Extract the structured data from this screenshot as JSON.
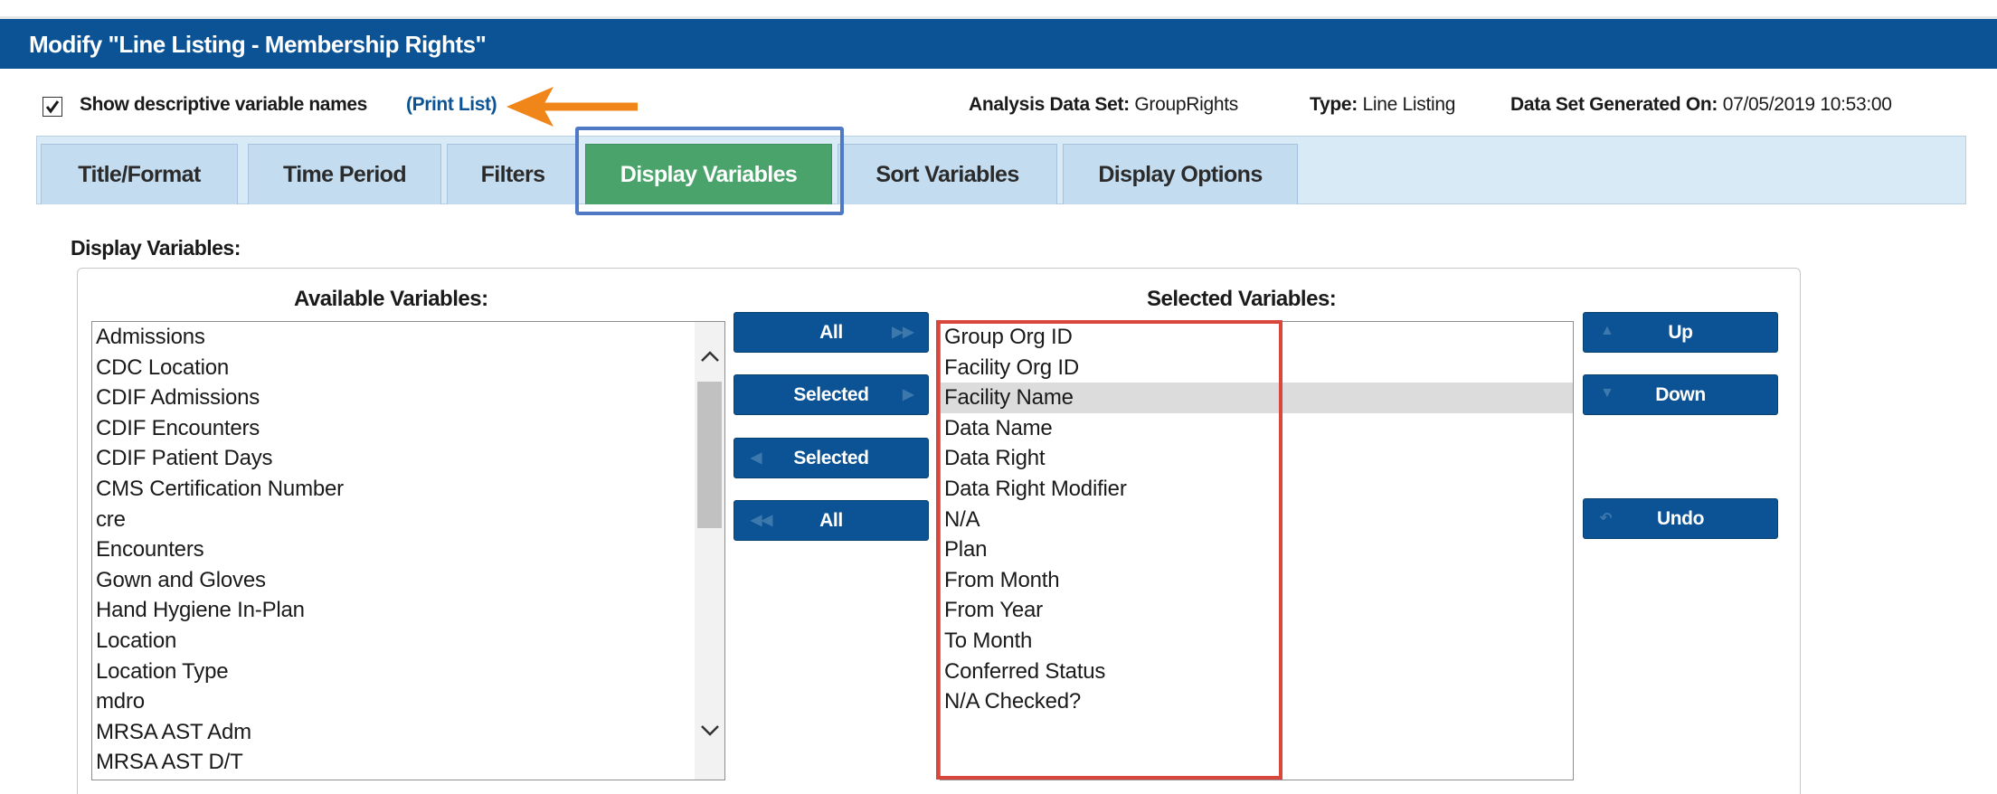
{
  "header": {
    "title": "Modify \"Line Listing - Membership Rights\""
  },
  "options": {
    "show_descriptive_checked": true,
    "show_descriptive_label": "Show descriptive variable names",
    "print_list_link": "(Print List)"
  },
  "meta": {
    "analysis_label": "Analysis Data Set:",
    "analysis_value": "GroupRights",
    "type_label": "Type:",
    "type_value": "Line Listing",
    "generated_label": "Data Set Generated On:",
    "generated_value": "07/05/2019 10:53:00"
  },
  "tabs": [
    {
      "label": "Title/Format",
      "active": false
    },
    {
      "label": "Time Period",
      "active": false
    },
    {
      "label": "Filters",
      "active": false
    },
    {
      "label": "Display Variables",
      "active": true
    },
    {
      "label": "Sort Variables",
      "active": false
    },
    {
      "label": "Display Options",
      "active": false
    }
  ],
  "section_label": "Display Variables:",
  "available": {
    "title": "Available Variables:",
    "items": [
      "Admissions",
      "CDC Location",
      "CDIF Admissions",
      "CDIF Encounters",
      "CDIF Patient Days",
      "CMS Certification Number",
      "cre",
      "Encounters",
      "Gown and Gloves",
      "Hand Hygiene In-Plan",
      "Location",
      "Location Type",
      "mdro",
      "MRSA AST Adm",
      "MRSA AST D/T"
    ]
  },
  "move_buttons": {
    "add_all": "All",
    "add_selected": "Selected",
    "remove_selected": "Selected",
    "remove_all": "All"
  },
  "selected": {
    "title": "Selected Variables:",
    "items": [
      "Group Org ID",
      "Facility Org ID",
      "Facility Name",
      "Data Name",
      "Data Right",
      "Data Right Modifier",
      "N/A",
      "Plan",
      "From Month",
      "From Year",
      "To Month",
      "Conferred Status",
      "N/A Checked?"
    ],
    "highlighted_index": 2
  },
  "order_buttons": {
    "up": "Up",
    "down": "Down",
    "undo": "Undo"
  },
  "colors": {
    "header": "#0b5394",
    "active_tab": "#4aa36a",
    "highlight_box": "#d9463b",
    "focus_outline": "#4f79c5",
    "arrow": "#f08519"
  }
}
